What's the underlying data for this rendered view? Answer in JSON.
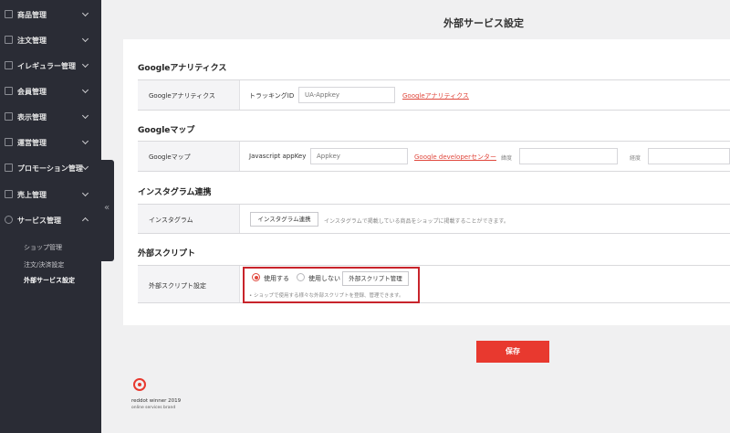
{
  "sidebar": {
    "items": [
      {
        "label": "商品管理",
        "icon": "box-icon"
      },
      {
        "label": "注文管理",
        "icon": "document-icon"
      },
      {
        "label": "イレギュラー管理",
        "icon": "checklist-icon"
      },
      {
        "label": "会員管理",
        "icon": "user-icon"
      },
      {
        "label": "表示管理",
        "icon": "monitor-icon"
      },
      {
        "label": "運営管理",
        "icon": "store-icon"
      },
      {
        "label": "プロモーション管理",
        "icon": "megaphone-icon"
      },
      {
        "label": "売上管理",
        "icon": "bar-chart-icon"
      },
      {
        "label": "サービス管理",
        "icon": "gear-icon"
      }
    ],
    "sub_items": [
      {
        "label": "ショップ管理"
      },
      {
        "label": "注文/決済設定"
      },
      {
        "label": "外部サービス設定"
      }
    ],
    "collapse_glyph": "«"
  },
  "page": {
    "title": "外部サービス設定"
  },
  "sections": {
    "analytics": {
      "title": "Googleアナリティクス",
      "row_label": "Googleアナリティクス",
      "tracking_label": "トラッキングID",
      "tracking_placeholder": "UA-Appkey",
      "link": "Googleアナリティクス"
    },
    "maps": {
      "title": "Googleマップ",
      "row_label": "Googleマップ",
      "js_label": "Javascript appKey",
      "js_placeholder": "Appkey",
      "link": "Google developerセンター",
      "lat_label": "緯度",
      "lng_label": "経度"
    },
    "instagram": {
      "title": "インスタグラム連携",
      "row_label": "インスタグラム",
      "button": "インスタグラム連携",
      "note": "インスタグラムで掲載している商品をショップに掲載することができます。"
    },
    "script": {
      "title": "外部スクリプト",
      "row_label": "外部スクリプト設定",
      "radio_use": "使用する",
      "radio_unused": "使用しない",
      "button": "外部スクリプト管理",
      "note": "• ショップで使用する様々な外部スクリプトを登録、管理できます。"
    }
  },
  "actions": {
    "save": "保存"
  },
  "award": {
    "line1": "reddot winner 2019",
    "line2": "online services brand"
  },
  "colors": {
    "accent": "#e8392f",
    "sidebar_bg": "#2a2c35",
    "highlight": "#c8242b"
  }
}
